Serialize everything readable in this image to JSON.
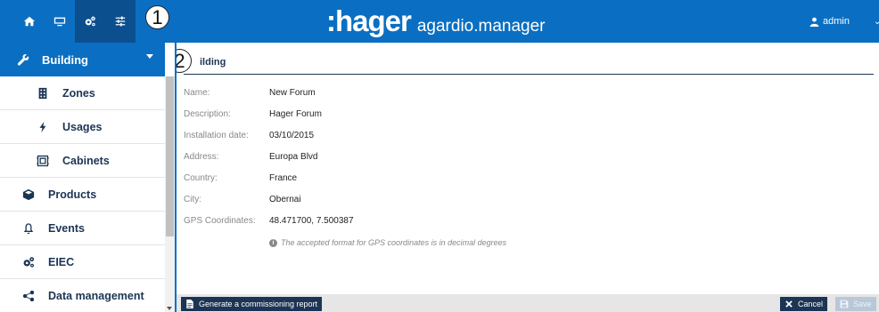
{
  "header": {
    "brand_logo": ":hager",
    "brand_app": "agardio.manager",
    "user_name": "admin",
    "icons": [
      "home-icon",
      "monitor-icon",
      "gears-icon",
      "sliders-icon"
    ]
  },
  "callouts": [
    "1",
    "2"
  ],
  "sidebar": {
    "head_label": "Building",
    "items": [
      {
        "label": "Zones",
        "icon": "building-icon"
      },
      {
        "label": "Usages",
        "icon": "bolt-icon"
      },
      {
        "label": "Cabinets",
        "icon": "cabinet-icon"
      },
      {
        "label": "Products",
        "icon": "cube-icon"
      },
      {
        "label": "Events",
        "icon": "bell-icon"
      },
      {
        "label": "EIEC",
        "icon": "gears-icon"
      },
      {
        "label": "Data management",
        "icon": "share-icon"
      }
    ]
  },
  "main": {
    "tab_title": "ilding",
    "fields": [
      {
        "label": "Name:",
        "value": "New Forum"
      },
      {
        "label": "Description:",
        "value": "Hager Forum"
      },
      {
        "label": "Installation date:",
        "value": "03/10/2015"
      },
      {
        "label": "Address:",
        "value": "Europa Blvd"
      },
      {
        "label": "Country:",
        "value": "France"
      },
      {
        "label": "City:",
        "value": "Obernai"
      },
      {
        "label": "GPS Coordinates:",
        "value": "48.471700, 7.500387"
      }
    ],
    "hint": "The accepted format for GPS coordinates is in decimal degrees"
  },
  "footer": {
    "report_label": "Generate a commissioning report",
    "cancel_label": "Cancel",
    "save_label": "Save"
  },
  "colors": {
    "brand_blue": "#0a6fc2",
    "navy": "#1c3555",
    "active_tab": "#0b4f8e"
  }
}
